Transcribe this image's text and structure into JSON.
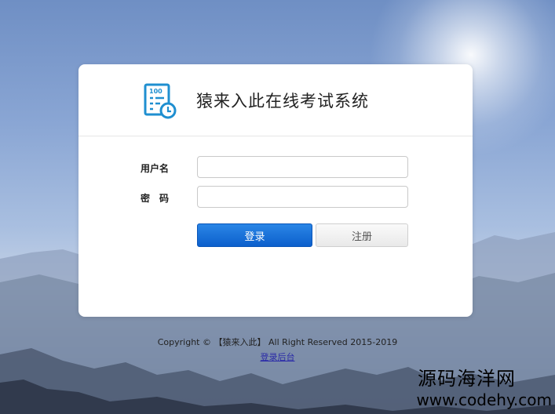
{
  "brand": {
    "title": "猿来入此在线考试系统",
    "logo_text": "100",
    "accent_color": "#1f8fd0"
  },
  "form": {
    "username_label": "用户名",
    "password_label": "密　码",
    "username_value": "",
    "password_value": "",
    "login_label": "登录",
    "register_label": "注册"
  },
  "footer": {
    "copyright": "Copyright © 【猿来入此】 All Right Reserved 2015-2019",
    "admin_link": "登录后台"
  },
  "watermark": {
    "name": "源码海洋网",
    "url": "www.codehy.com"
  },
  "colors": {
    "primary_button": "#0c5fcc",
    "link": "#2a2aa8"
  }
}
